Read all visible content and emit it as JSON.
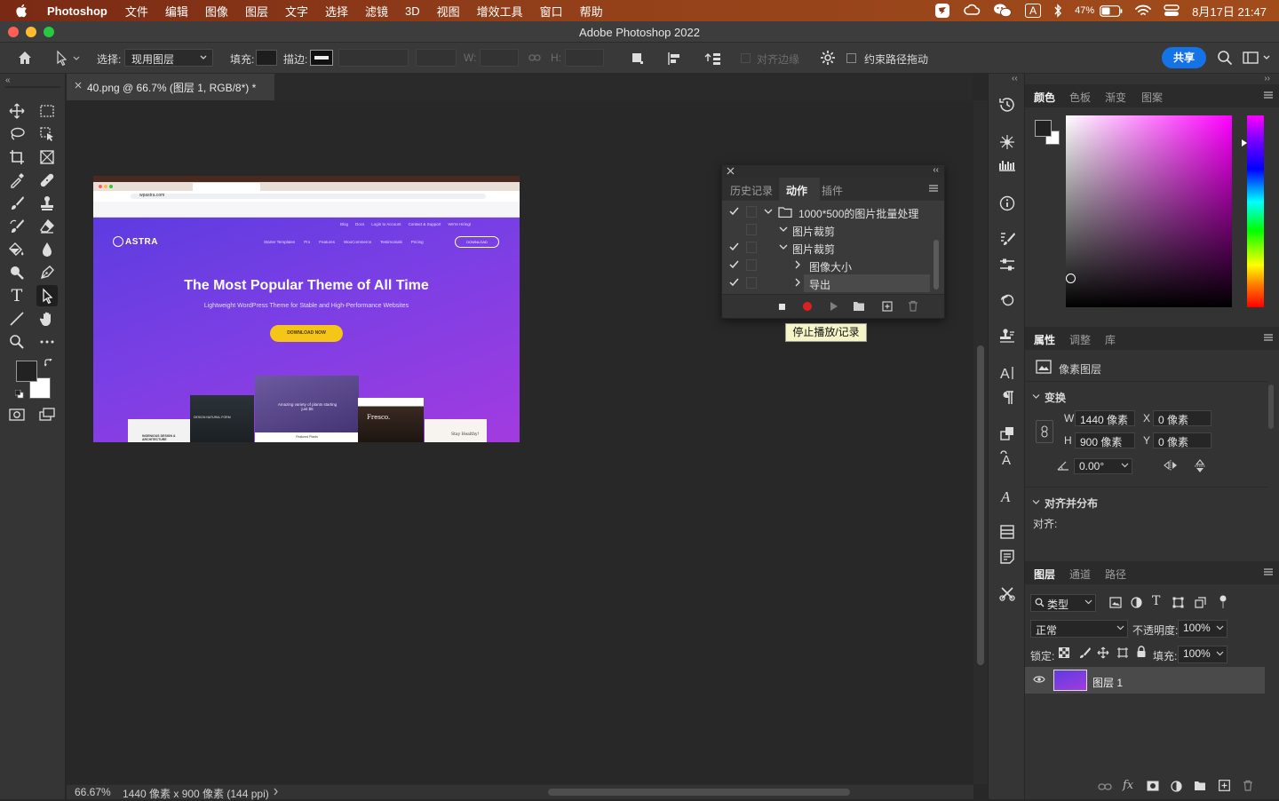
{
  "menubar": {
    "app": "Photoshop",
    "items": [
      "文件",
      "编辑",
      "图像",
      "图层",
      "文字",
      "选择",
      "滤镜",
      "3D",
      "视图",
      "增效工具",
      "窗口",
      "帮助"
    ],
    "battery": "47%",
    "clock": "8月17日  21:47",
    "input_method": "A"
  },
  "window": {
    "title": "Adobe Photoshop 2022"
  },
  "options": {
    "select_label": "选择:",
    "select_value": "现用图层",
    "fill_label": "填充:",
    "stroke_label": "描边:",
    "w_label": "W:",
    "h_label": "H:",
    "align_edges": "对齐边缘",
    "constrain_path": "约束路径拖动",
    "share": "共享"
  },
  "document": {
    "tab_title": "40.png @ 66.7% (图层 1, RGB/8*) *",
    "zoom": "66.67%",
    "info": "1440 像素 x 900 像素 (144 ppi)"
  },
  "thumbnail": {
    "brand": "ASTRA",
    "headline": "The Most Popular Theme of All Time",
    "subline": "Lightweight WordPress Theme for Stable and High-Performance Websites",
    "cta": "DOWNLOAD NOW",
    "nav": [
      "Blog",
      "Docs",
      "Login to Account",
      "Contact & Support",
      "We're Hiring!"
    ],
    "menu": [
      "Starter Templates",
      "Pro",
      "Features",
      "WooCommerce",
      "Testimonials",
      "Pricing"
    ],
    "nav_button": "DOWNLOAD",
    "url": "wpastra.com",
    "card_fresco": "Fresco.",
    "card_plants": "Amazing variety of plants starting just $6",
    "card_stay": "Stay Healthy!",
    "card_ingenious": "INGENIOUS DESIGN & ARCHITECTURE",
    "card_featured": "Featured Plants",
    "card_nature": "DESIGN NATURAL FORM"
  },
  "actions_panel": {
    "tabs": [
      "历史记录",
      "动作",
      "插件"
    ],
    "active_tab": "动作",
    "rows": [
      {
        "label": "1000*500的图片批量处理",
        "checked": true
      },
      {
        "label": "图片裁剪",
        "checked": false
      },
      {
        "label": "图片裁剪",
        "checked": true
      },
      {
        "label": "图像大小",
        "checked": true
      },
      {
        "label": "导出",
        "checked": true
      }
    ],
    "tooltip": "停止播放/记录"
  },
  "color_panel": {
    "tabs": [
      "颜色",
      "色板",
      "渐变",
      "图案"
    ],
    "active_tab": "颜色"
  },
  "properties_panel": {
    "tabs": [
      "属性",
      "调整",
      "库"
    ],
    "layer_type": "像素图层",
    "transform_title": "变换",
    "w_label": "W",
    "w_value": "1440 像素",
    "h_label": "H",
    "h_value": "900 像素",
    "x_label": "X",
    "x_value": "0 像素",
    "y_label": "Y",
    "y_value": "0 像素",
    "angle_value": "0.00°",
    "align_title": "对齐并分布",
    "align_label": "对齐:"
  },
  "layers_panel": {
    "tabs": [
      "图层",
      "通道",
      "路径"
    ],
    "filter_kind": "类型",
    "blend_mode": "正常",
    "opacity_label": "不透明度:",
    "opacity_value": "100%",
    "lock_label": "锁定:",
    "fill_label": "填充:",
    "fill_value": "100%",
    "layers": [
      {
        "name": "图层 1",
        "visible": true
      }
    ]
  },
  "colors": {
    "share_blue": "#1473e6",
    "record_red": "#e02020",
    "astra_purple": "#7b3fe4",
    "cta_yellow": "#f5c518"
  }
}
